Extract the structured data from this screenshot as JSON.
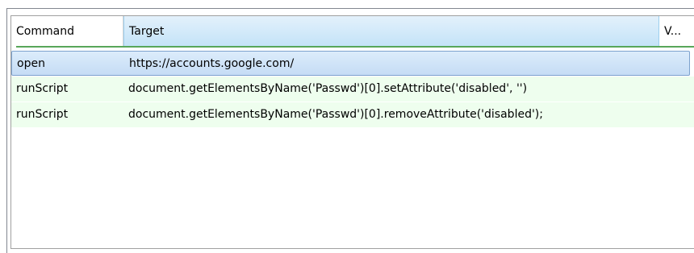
{
  "header": {
    "columns": {
      "command": "Command",
      "target": "Target",
      "value": "V..."
    }
  },
  "rows": [
    {
      "command": "open",
      "target": "https://accounts.google.com/",
      "selected": true
    },
    {
      "command": "runScript",
      "target": "document.getElementsByName('Passwd')[0].setAttribute('disabled', '')",
      "selected": false
    },
    {
      "command": "runScript",
      "target": "document.getElementsByName('Passwd')[0].removeAttribute('disabled');",
      "selected": false
    }
  ],
  "colors": {
    "selected_row": "#c5dcf5",
    "script_row": "#eefeee",
    "header_active": "#c4e3f8",
    "accent_line": "#58a65a"
  }
}
